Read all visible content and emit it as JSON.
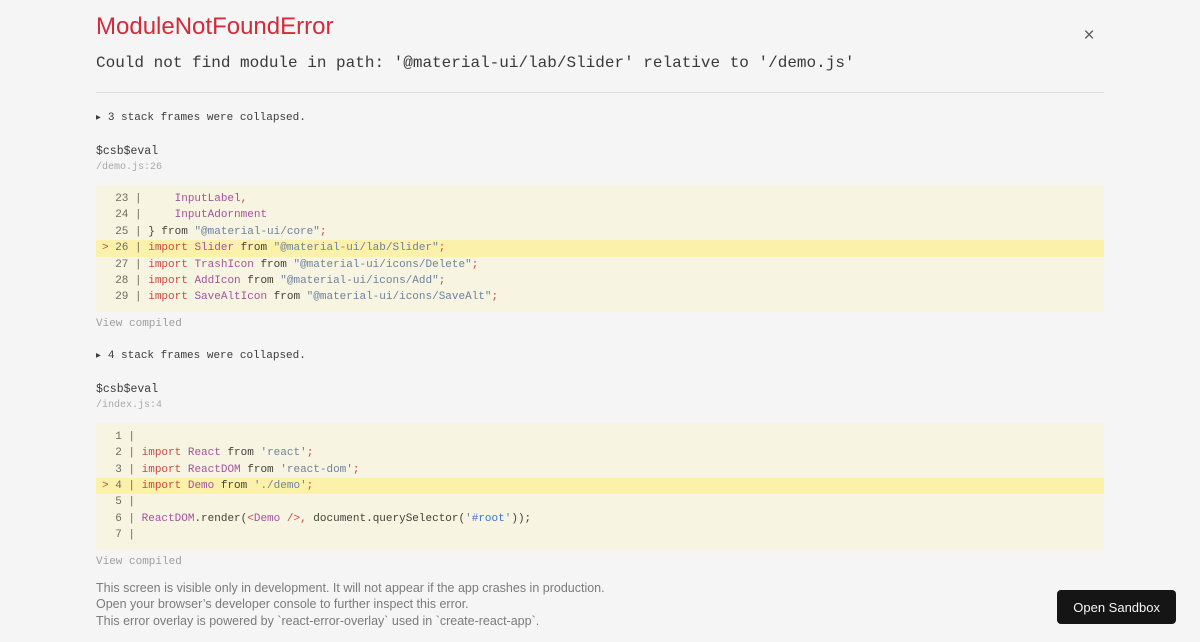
{
  "overlay": {
    "title": "ModuleNotFoundError",
    "message": "Could not find module in path: '@material-ui/lab/Slider' relative to '/demo.js'"
  },
  "icons": {
    "close": "×",
    "collapsed_triangle": "▶"
  },
  "colors": {
    "title_red": "#d22b3a",
    "code_background": "#f7f4e1",
    "highlight_background": "#fbf1aa",
    "keyword": "#c84b42",
    "identifier": "#a3539e",
    "string": "#6e82a0",
    "hash_selector": "#3f74d4",
    "button_background": "#151515"
  },
  "frames": [
    {
      "collapsed": "3 stack frames were collapsed.",
      "function": "$csb$eval",
      "location": "/demo.js:26",
      "view_compiled": "View compiled",
      "gutter_digits": 2,
      "lines": [
        {
          "num": 23,
          "highlight": false,
          "tokens": [
            [
              "p",
              "    "
            ],
            [
              "i",
              "InputLabel"
            ],
            [
              "r",
              ","
            ]
          ]
        },
        {
          "num": 24,
          "highlight": false,
          "tokens": [
            [
              "p",
              "    "
            ],
            [
              "i",
              "InputAdornment"
            ]
          ]
        },
        {
          "num": 25,
          "highlight": false,
          "tokens": [
            [
              "p",
              "} from "
            ],
            [
              "s",
              "\"@material-ui/core\""
            ],
            [
              "r",
              ";"
            ]
          ]
        },
        {
          "num": 26,
          "highlight": true,
          "tokens": [
            [
              "k",
              "import"
            ],
            [
              "p",
              " "
            ],
            [
              "i",
              "Slider"
            ],
            [
              "p",
              " from "
            ],
            [
              "s",
              "\"@material-ui/lab/Slider\""
            ],
            [
              "r",
              ";"
            ]
          ]
        },
        {
          "num": 27,
          "highlight": false,
          "tokens": [
            [
              "k",
              "import"
            ],
            [
              "p",
              " "
            ],
            [
              "i",
              "TrashIcon"
            ],
            [
              "p",
              " from "
            ],
            [
              "s",
              "\"@material-ui/icons/Delete\""
            ],
            [
              "r",
              ";"
            ]
          ]
        },
        {
          "num": 28,
          "highlight": false,
          "tokens": [
            [
              "k",
              "import"
            ],
            [
              "p",
              " "
            ],
            [
              "i",
              "AddIcon"
            ],
            [
              "p",
              " from "
            ],
            [
              "s",
              "\"@material-ui/icons/Add\""
            ],
            [
              "r",
              ";"
            ]
          ]
        },
        {
          "num": 29,
          "highlight": false,
          "tokens": [
            [
              "k",
              "import"
            ],
            [
              "p",
              " "
            ],
            [
              "i",
              "SaveAltIcon"
            ],
            [
              "p",
              " from "
            ],
            [
              "s",
              "\"@material-ui/icons/SaveAlt\""
            ],
            [
              "r",
              ";"
            ]
          ]
        }
      ]
    },
    {
      "collapsed": "4 stack frames were collapsed.",
      "function": "$csb$eval",
      "location": "/index.js:4",
      "view_compiled": "View compiled",
      "gutter_digits": 1,
      "lines": [
        {
          "num": 1,
          "highlight": false,
          "tokens": []
        },
        {
          "num": 2,
          "highlight": false,
          "tokens": [
            [
              "k",
              "import"
            ],
            [
              "p",
              " "
            ],
            [
              "i",
              "React"
            ],
            [
              "p",
              " from "
            ],
            [
              "s",
              "'react'"
            ],
            [
              "r",
              ";"
            ]
          ]
        },
        {
          "num": 3,
          "highlight": false,
          "tokens": [
            [
              "k",
              "import"
            ],
            [
              "p",
              " "
            ],
            [
              "i",
              "ReactDOM"
            ],
            [
              "p",
              " from "
            ],
            [
              "s",
              "'react-dom'"
            ],
            [
              "r",
              ";"
            ]
          ]
        },
        {
          "num": 4,
          "highlight": true,
          "tokens": [
            [
              "k",
              "import"
            ],
            [
              "p",
              " "
            ],
            [
              "i",
              "Demo"
            ],
            [
              "p",
              " from "
            ],
            [
              "s",
              "'./demo'"
            ],
            [
              "r",
              ";"
            ]
          ]
        },
        {
          "num": 5,
          "highlight": false,
          "tokens": []
        },
        {
          "num": 6,
          "highlight": false,
          "tokens": [
            [
              "i",
              "ReactDOM"
            ],
            [
              "p",
              ".render("
            ],
            [
              "k",
              "<"
            ],
            [
              "i",
              "Demo"
            ],
            [
              "p",
              " "
            ],
            [
              "k",
              "/>"
            ],
            [
              "r",
              ","
            ],
            [
              "p",
              " document.querySelector("
            ],
            [
              "s",
              "'"
            ],
            [
              "h",
              "#root"
            ],
            [
              "s",
              "'"
            ],
            [
              "p",
              "));"
            ]
          ]
        },
        {
          "num": 7,
          "highlight": false,
          "tokens": []
        }
      ]
    }
  ],
  "footer": {
    "lines": [
      "This screen is visible only in development. It will not appear if the app crashes in production.",
      "Open your browser’s developer console to further inspect this error.",
      "This error overlay is powered by `react-error-overlay` used in `create-react-app`."
    ],
    "open_sandbox": "Open Sandbox"
  }
}
